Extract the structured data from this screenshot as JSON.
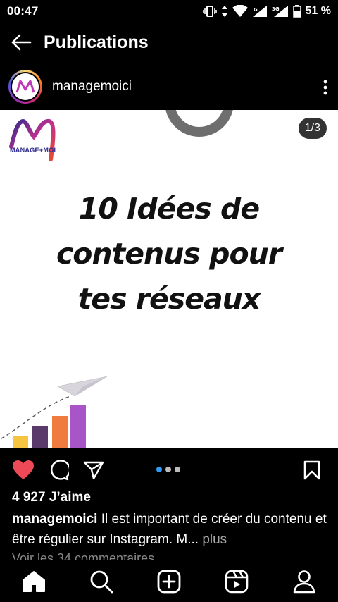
{
  "status_bar": {
    "time": "00:47",
    "battery": "51 %",
    "network": "G",
    "network2": "3G"
  },
  "header": {
    "title": "Publications"
  },
  "post": {
    "username": "managemoici",
    "counter": "1/3",
    "heading": [
      "10 Idées de",
      "contenus pour",
      "tes réseaux"
    ],
    "brand_text": "MANAGE+MOI",
    "likes": "4 927 J’aime",
    "caption_user": "managemoici",
    "caption_text": " Il est important de créer du contenu et être régulier sur Instagram. M...",
    "caption_more": " plus",
    "comments_link": "Voir les 34 commentaires",
    "carousel": {
      "total": 3,
      "active": 1
    }
  },
  "icons": {
    "back": "arrow-left-icon",
    "more": "more-vertical-icon",
    "like": "heart-icon",
    "comment": "comment-icon",
    "share": "send-icon",
    "save": "bookmark-icon",
    "home": "home-icon",
    "search": "search-icon",
    "create": "add-icon",
    "reels": "reels-icon",
    "profile": "profile-icon"
  },
  "colors": {
    "like": "#ed4956",
    "carousel_active": "#2f9bf7",
    "bars": [
      "#f5c542",
      "#5a3a6b",
      "#f07b3f",
      "#a855c8"
    ]
  }
}
